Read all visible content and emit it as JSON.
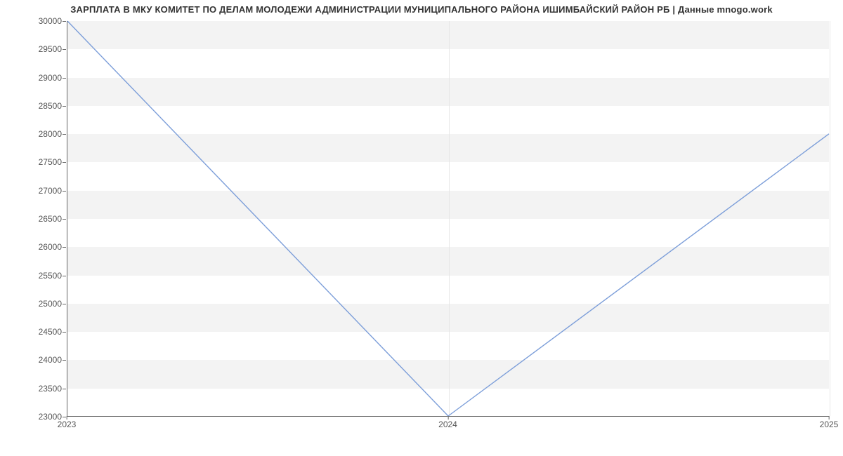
{
  "chart_data": {
    "type": "line",
    "title": "ЗАРПЛАТА В МКУ КОМИТЕТ ПО ДЕЛАМ МОЛОДЕЖИ АДМИНИСТРАЦИИ МУНИЦИПАЛЬНОГО РАЙОНА ИШИМБАЙСКИЙ РАЙОН РБ | Данные mnogo.work",
    "x": [
      2023,
      2024,
      2025
    ],
    "values": [
      30000,
      23000,
      28000
    ],
    "xlabel": "",
    "ylabel": "",
    "xticks": [
      2023,
      2024,
      2025
    ],
    "yticks": [
      23000,
      23500,
      24000,
      24500,
      25000,
      25500,
      26000,
      26500,
      27000,
      27500,
      28000,
      28500,
      29000,
      29500,
      30000
    ],
    "ylim": [
      23000,
      30000
    ],
    "xlim": [
      2023,
      2025
    ],
    "grid": true
  },
  "colors": {
    "line": "#7c9ed9",
    "band": "#f3f3f3"
  }
}
